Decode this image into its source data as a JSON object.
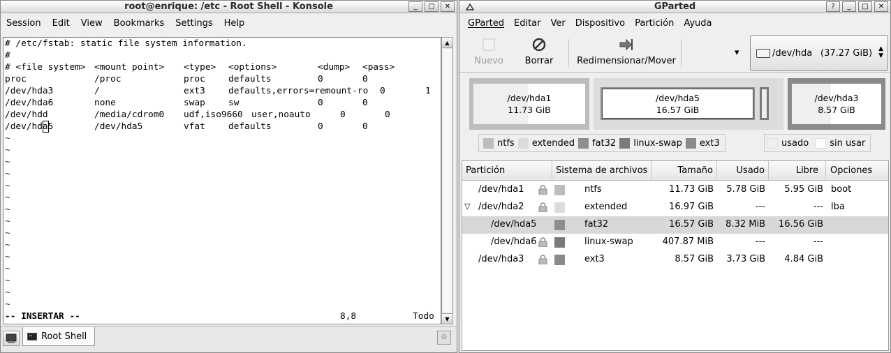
{
  "konsole": {
    "title": "root@enrique: /etc - Root Shell - Konsole",
    "window_buttons": [
      "_",
      "□",
      "✕"
    ],
    "menu": [
      "Session",
      "Edit",
      "View",
      "Bookmarks",
      "Settings",
      "Help"
    ],
    "comments": [
      "# /etc/fstab: static file system information.",
      "#"
    ],
    "header_row": [
      "# <file system>",
      "<mount point>",
      "<type>",
      "<options>",
      "<dump>",
      "<pass>"
    ],
    "rows": [
      [
        "proc",
        "/proc",
        "proc",
        "defaults",
        "0",
        "0"
      ],
      [
        "/dev/hda3",
        "/",
        "ext3",
        "defaults,errors=remount-ro",
        "0",
        "1"
      ],
      [
        "/dev/hda6",
        "none",
        "swap",
        "sw",
        "0",
        "0"
      ],
      [
        "/dev/hdd",
        "/media/cdrom0",
        "udf,iso9660",
        "user,noauto",
        "0",
        "0"
      ],
      [
        "/dev/hda5",
        "/dev/hda5",
        "vfat",
        "defaults",
        "0",
        "0"
      ]
    ],
    "tilde": "~",
    "status_mode": "-- INSERTAR --",
    "status_pos": "8,8",
    "status_all": "Todo",
    "tab_label": "Root Shell"
  },
  "gparted": {
    "title": "GParted",
    "window_buttons": [
      "?",
      "_",
      "□",
      "✕"
    ],
    "menu": [
      "GParted",
      "Editar",
      "Ver",
      "Dispositivo",
      "Partición",
      "Ayuda"
    ],
    "toolbar": {
      "new_label": "Nuevo",
      "delete_label": "Borrar",
      "resize_label": "Redimensionar/Mover",
      "dropdown_arrow": "▾"
    },
    "device": {
      "name": "/dev/hda",
      "size": "(37.27 GiB)"
    },
    "map": [
      {
        "name": "/dev/hda1",
        "size": "11.73 GiB",
        "used_fraction": 0.49
      },
      {
        "name": "/dev/hda5",
        "size": "16.57 GiB",
        "used_fraction": 0.0
      },
      {
        "name": "/dev/hda3",
        "size": "8.57 GiB",
        "used_fraction": 0.44
      }
    ],
    "legend_fs": [
      {
        "label": "ntfs",
        "color": "#bdbdbd"
      },
      {
        "label": "extended",
        "color": "#dcdcdc"
      },
      {
        "label": "fat32",
        "color": "#8e8e8e"
      },
      {
        "label": "linux-swap",
        "color": "#7a7a7a"
      },
      {
        "label": "ext3",
        "color": "#8a8a8a"
      }
    ],
    "legend_use": [
      {
        "label": "usado",
        "color": "#efefef"
      },
      {
        "label": "sin usar",
        "color": "#ffffff"
      }
    ],
    "columns": [
      "Partición",
      "Sistema de archivos",
      "Tamaño",
      "Usado",
      "Libre",
      "Opciones"
    ],
    "partitions": [
      {
        "name": "/dev/hda1",
        "fs": "ntfs",
        "color": "#bdbdbd",
        "size": "11.73 GiB",
        "used": "5.78 GiB",
        "free": "5.95 GiB",
        "flags": "boot",
        "locked": true,
        "level": 0,
        "expander": "",
        "selected": false
      },
      {
        "name": "/dev/hda2",
        "fs": "extended",
        "color": "#dcdcdc",
        "size": "16.97 GiB",
        "used": "---",
        "free": "---",
        "flags": "lba",
        "locked": true,
        "level": 0,
        "expander": "▽",
        "selected": false
      },
      {
        "name": "/dev/hda5",
        "fs": "fat32",
        "color": "#8e8e8e",
        "size": "16.57 GiB",
        "used": "8.32 MiB",
        "free": "16.56 GiB",
        "flags": "",
        "locked": false,
        "level": 1,
        "expander": "",
        "selected": true
      },
      {
        "name": "/dev/hda6",
        "fs": "linux-swap",
        "color": "#7a7a7a",
        "size": "407.87 MiB",
        "used": "---",
        "free": "---",
        "flags": "",
        "locked": true,
        "level": 1,
        "expander": "",
        "selected": false
      },
      {
        "name": "/dev/hda3",
        "fs": "ext3",
        "color": "#8a8a8a",
        "size": "8.57 GiB",
        "used": "3.73 GiB",
        "free": "4.84 GiB",
        "flags": "",
        "locked": true,
        "level": 0,
        "expander": "",
        "selected": false
      }
    ]
  }
}
